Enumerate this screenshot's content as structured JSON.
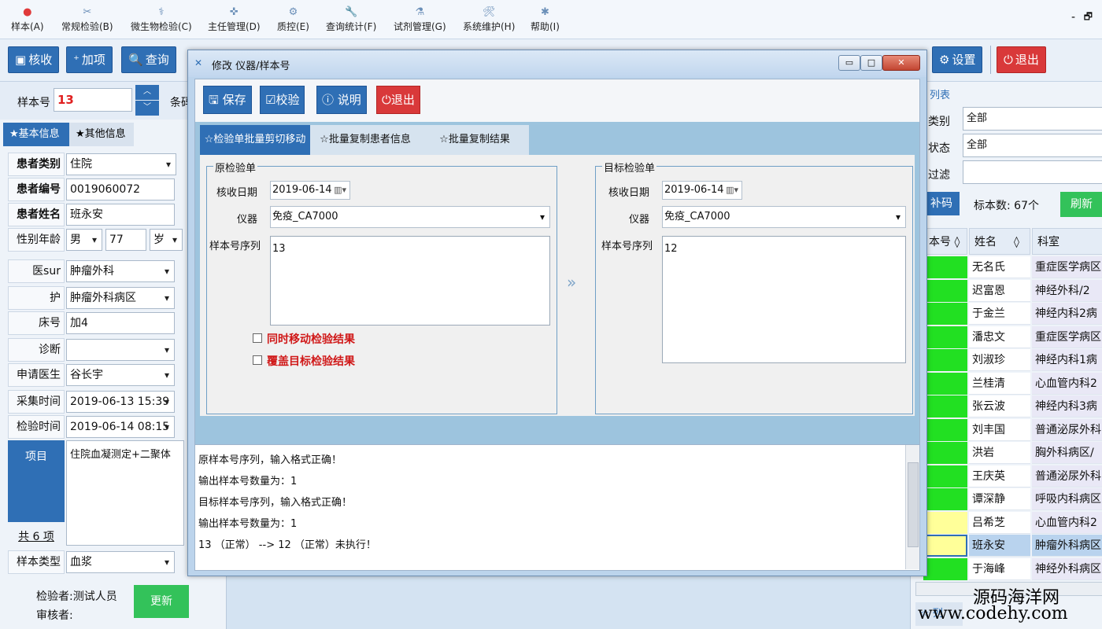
{
  "menu": [
    {
      "label": "样本(A)",
      "icon": "sample-icon"
    },
    {
      "label": "常规检验(B)",
      "icon": "routine-test-icon"
    },
    {
      "label": "微生物检验(C)",
      "icon": "microbe-icon"
    },
    {
      "label": "主任管理(D)",
      "icon": "director-icon"
    },
    {
      "label": "质控(E)",
      "icon": "qc-icon"
    },
    {
      "label": "查询统计(F)",
      "icon": "query-icon"
    },
    {
      "label": "试剂管理(G)",
      "icon": "reagent-icon"
    },
    {
      "label": "系统维护(H)",
      "icon": "maintenance-icon"
    },
    {
      "label": "帮助(I)",
      "icon": "help-icon"
    }
  ],
  "window_controls": {
    "minimize": "-",
    "restore": "🗗"
  },
  "toolbar": {
    "receive": "核收",
    "add_item": "加项",
    "query": "查询",
    "settings": "设置",
    "exit": "退出"
  },
  "left": {
    "sample_label": "样本号",
    "sample_value": "13",
    "barcode_label": "条码",
    "tab_basic": "★基本信息",
    "tab_other": "★其他信息",
    "fields": [
      {
        "label": "患者类别",
        "value": "住院",
        "bold": true,
        "dropdown": true
      },
      {
        "label": "患者编号",
        "value": "0019060072",
        "bold": true,
        "dropdown": false
      },
      {
        "label": "患者姓名",
        "value": "班永安",
        "bold": true,
        "dropdown": false
      },
      {
        "label": "性别年龄",
        "value": "",
        "bold": false,
        "dropdown": false
      },
      {
        "label": "医sur",
        "value": "肿瘤外科",
        "bold": false,
        "dropdown": true
      },
      {
        "label": "护",
        "value": "肿瘤外科病区",
        "bold": false,
        "dropdown": true
      },
      {
        "label": "床号",
        "value": "加4",
        "bold": false,
        "dropdown": false
      },
      {
        "label": "诊断",
        "value": "",
        "bold": false,
        "dropdown": true
      },
      {
        "label": "申请医生",
        "value": "谷长宇",
        "bold": false,
        "dropdown": true
      },
      {
        "label": "采集时间",
        "value": "2019-06-13 15:39",
        "bold": false,
        "dropdown": true
      },
      {
        "label": "检验时间",
        "value": "2019-06-14 08:15",
        "bold": false,
        "dropdown": true
      }
    ],
    "sex": "男",
    "age": "77",
    "age_unit": "岁",
    "items_label": "项目",
    "items_value": "住院血凝测定+二聚体",
    "items_total": "共 6 项",
    "sample_type_label": "样本类型",
    "sample_type_value": "血浆",
    "checker": "检验者:测试人员",
    "reviewer": "审核者:",
    "update": "更新"
  },
  "right": {
    "title": "列表",
    "category_label": "类别",
    "category_value": "全部",
    "status_label": "状态",
    "status_value": "全部",
    "filter_label": "过滤",
    "supplement": "补码",
    "count": "标本数: 67个",
    "refresh": "刷新",
    "headers": {
      "sample_no": "本号 ◊",
      "name": "姓名",
      "name_sort": "◊",
      "dept": "科室"
    },
    "rows": [
      {
        "name": "无名氏",
        "dept": "重症医学病区",
        "status": "green"
      },
      {
        "name": "迟富恩",
        "dept": "神经外科/2",
        "status": "green"
      },
      {
        "name": "于金兰",
        "dept": "神经内科2病",
        "status": "green"
      },
      {
        "name": "潘忠文",
        "dept": "重症医学病区",
        "status": "green"
      },
      {
        "name": "刘淑珍",
        "dept": "神经内科1病",
        "status": "green"
      },
      {
        "name": "兰桂清",
        "dept": "心血管内科2",
        "status": "green"
      },
      {
        "name": "张云波",
        "dept": "神经内科3病",
        "status": "green"
      },
      {
        "name": "刘丰国",
        "dept": "普通泌尿外科",
        "status": "green"
      },
      {
        "name": "洪岩",
        "dept": "胸外科病区/",
        "status": "green"
      },
      {
        "name": "王庆英",
        "dept": "普通泌尿外科",
        "status": "green"
      },
      {
        "name": "谭深静",
        "dept": "呼吸内科病区",
        "status": "green"
      },
      {
        "name": "吕希芝",
        "dept": "心血管内科2",
        "status": "yellow"
      },
      {
        "name": "班永安",
        "dept": "肿瘤外科病区",
        "status": "yellow-selected"
      },
      {
        "name": "于海峰",
        "dept": "神经外科病区",
        "status": "green"
      }
    ],
    "list_tab": "☆ 列",
    "watermark1": "源码海洋网",
    "watermark2": "www.codehy.com"
  },
  "dialog": {
    "title": "修改 仪器/样本号",
    "buttons": {
      "save": "保存",
      "verify": "校验",
      "explain": "说明",
      "exit": "退出"
    },
    "tabs": [
      "☆检验单批量剪切移动",
      "☆批量复制患者信息",
      "☆批量复制结果"
    ],
    "source": {
      "title": "原检验单",
      "date_label": "核收日期",
      "date": "2019-06-14",
      "instrument_label": "仪器",
      "instrument": "免疫_CA7000",
      "seq_label": "样本号序列",
      "seq": "13",
      "chk_move": "同时移动检验结果",
      "chk_overwrite": "覆盖目标检验结果"
    },
    "target": {
      "title": "目标检验单",
      "date_label": "核收日期",
      "date": "2019-06-14",
      "instrument_label": "仪器",
      "instrument": "免疫_CA7000",
      "seq_label": "样本号序列",
      "seq": "12"
    },
    "arrow": "»",
    "log": [
      "原样本号序列，输入格式正确！",
      "输出样本号数量为：1",
      "目标样本号序列，输入格式正确！",
      "输出样本号数量为：1",
      "13 （正常） --> 12 （正常）未执行！"
    ]
  },
  "colors": {
    "accent": "#2f6fb5",
    "exit": "#d9393a",
    "ok": "#33c25a",
    "status_green": "#22e022",
    "status_yellow": "#ffff99"
  }
}
